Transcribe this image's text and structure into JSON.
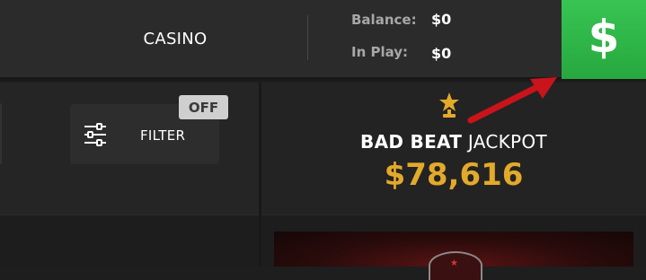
{
  "header": {
    "casino_tab": "CASINO",
    "balance_label": "Balance:",
    "balance_value": "$0",
    "inplay_label": "In Play:",
    "inplay_value": "$0",
    "deposit_symbol": "$"
  },
  "filter": {
    "label": "FILTER",
    "toggle_state": "OFF"
  },
  "jackpot": {
    "title_bold": "BAD BEAT",
    "title_rest": " JACKPOT",
    "amount": "$78,616"
  },
  "colors": {
    "deposit_green": "#2fb548",
    "jackpot_gold": "#e2a92b",
    "annotation_arrow": "#c8141a"
  },
  "icons": [
    "sliders-icon",
    "trophy-icon",
    "dollar-icon",
    "annotation-arrow-icon"
  ]
}
